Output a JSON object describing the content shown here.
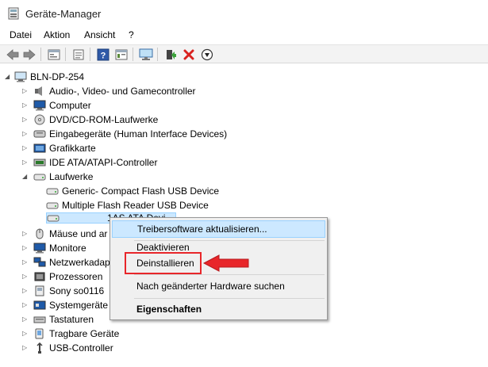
{
  "window": {
    "title": "Geräte-Manager"
  },
  "menubar": {
    "items": [
      "Datei",
      "Aktion",
      "Ansicht",
      "?"
    ]
  },
  "toolbar": {
    "buttons": [
      "back-arrow-icon",
      "forward-arrow-icon",
      "properties-icon",
      "console-icon",
      "help-icon",
      "view-icon",
      "monitor-icon",
      "update-driver-icon",
      "uninstall-x-icon",
      "disable-down-icon"
    ]
  },
  "tree": {
    "root": "BLN-DP-254",
    "items": [
      {
        "label": "Audio-, Video- und Gamecontroller",
        "icon": "audio-icon"
      },
      {
        "label": "Computer",
        "icon": "computer-icon"
      },
      {
        "label": "DVD/CD-ROM-Laufwerke",
        "icon": "dvd-icon"
      },
      {
        "label": "Eingabegeräte (Human Interface Devices)",
        "icon": "hid-icon"
      },
      {
        "label": "Grafikkarte",
        "icon": "display-adapter-icon"
      },
      {
        "label": "IDE ATA/ATAPI-Controller",
        "icon": "ide-icon"
      },
      {
        "label": "Laufwerke",
        "icon": "drive-icon"
      },
      {
        "label": "Generic- Compact Flash USB Device",
        "icon": "drive-icon"
      },
      {
        "label": "Multiple Flash Reader USB Device",
        "icon": "drive-icon"
      },
      {
        "label": "1AS ATA Devi",
        "icon": "drive-icon"
      },
      {
        "label": "Mäuse und ar",
        "icon": "mouse-icon"
      },
      {
        "label": "Monitore",
        "icon": "monitor-icon"
      },
      {
        "label": "Netzwerkadap",
        "icon": "network-icon"
      },
      {
        "label": "Prozessoren",
        "icon": "cpu-icon"
      },
      {
        "label": "Sony so0116",
        "icon": "device-icon"
      },
      {
        "label": "Systemgeräte",
        "icon": "system-icon"
      },
      {
        "label": "Tastaturen",
        "icon": "keyboard-icon"
      },
      {
        "label": "Tragbare Geräte",
        "icon": "portable-icon"
      },
      {
        "label": "USB-Controller",
        "icon": "usb-icon"
      }
    ]
  },
  "context_menu": {
    "items": [
      {
        "label": "Treibersoftware aktualisieren...",
        "highlighted": true
      },
      {
        "label": "Deaktivieren"
      },
      {
        "label": "Deinstallieren"
      },
      {
        "label": "Nach geänderter Hardware suchen"
      },
      {
        "label": "Eigenschaften",
        "bold": true
      }
    ]
  },
  "colors": {
    "highlight_bg": "#cce8ff",
    "highlight_border": "#99d1ff",
    "annotation_red": "#e8262a"
  }
}
